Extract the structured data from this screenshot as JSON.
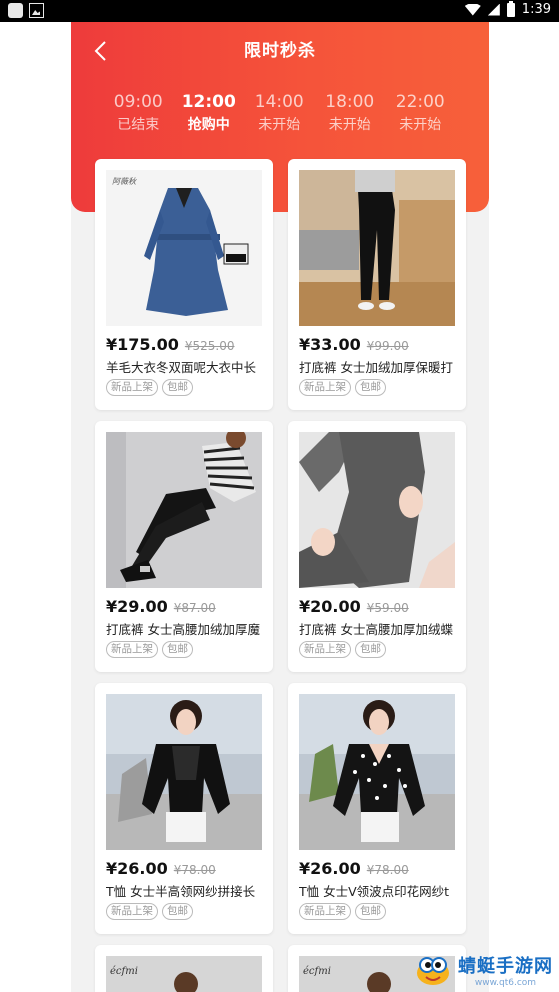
{
  "status_bar": {
    "time": "1:39"
  },
  "header": {
    "title": "限时秒杀"
  },
  "time_slots": [
    {
      "time": "09:00",
      "status": "已结束"
    },
    {
      "time": "12:00",
      "status": "抢购中"
    },
    {
      "time": "14:00",
      "status": "未开始"
    },
    {
      "time": "18:00",
      "status": "未开始"
    },
    {
      "time": "22:00",
      "status": "未开始"
    }
  ],
  "active_slot_index": 1,
  "products": [
    {
      "price": "¥175.00",
      "old_price": "¥525.00",
      "name": "羊毛大衣冬双面呢大衣中长",
      "tags": [
        "新品上架",
        "包邮"
      ],
      "image": "blue-wool-coat",
      "img_brand": "阿薇秋"
    },
    {
      "price": "¥33.00",
      "old_price": "¥99.00",
      "name": "打底裤 女士加绒加厚保暖打",
      "tags": [
        "新品上架",
        "包邮"
      ],
      "image": "black-leggings-room"
    },
    {
      "price": "¥29.00",
      "old_price": "¥87.00",
      "name": "打底裤 女士高腰加绒加厚魔",
      "tags": [
        "新品上架",
        "包邮"
      ],
      "image": "black-leggings-striped-top"
    },
    {
      "price": "¥20.00",
      "old_price": "¥59.00",
      "name": "打底裤 女士高腰加厚加绒蝶",
      "tags": [
        "新品上架",
        "包邮"
      ],
      "image": "grey-leggings-closeup"
    },
    {
      "price": "¥26.00",
      "old_price": "¥78.00",
      "name": "T恤 女士半高领网纱拼接长",
      "tags": [
        "新品上架",
        "包邮"
      ],
      "image": "black-lace-top"
    },
    {
      "price": "¥26.00",
      "old_price": "¥78.00",
      "name": "T恤 女士V领波点印花网纱t",
      "tags": [
        "新品上架",
        "包邮"
      ],
      "image": "polka-dot-top"
    },
    {
      "image": "brand-top-a",
      "img_brand": "écfmi"
    },
    {
      "image": "brand-top-b",
      "img_brand": "écfmi"
    }
  ],
  "watermark": {
    "name": "蜻蜓手游网",
    "url": "www.qt6.com"
  },
  "colors": {
    "header_start": "#ee3b3b",
    "header_end": "#f7603a",
    "background": "#f2f2f2"
  }
}
